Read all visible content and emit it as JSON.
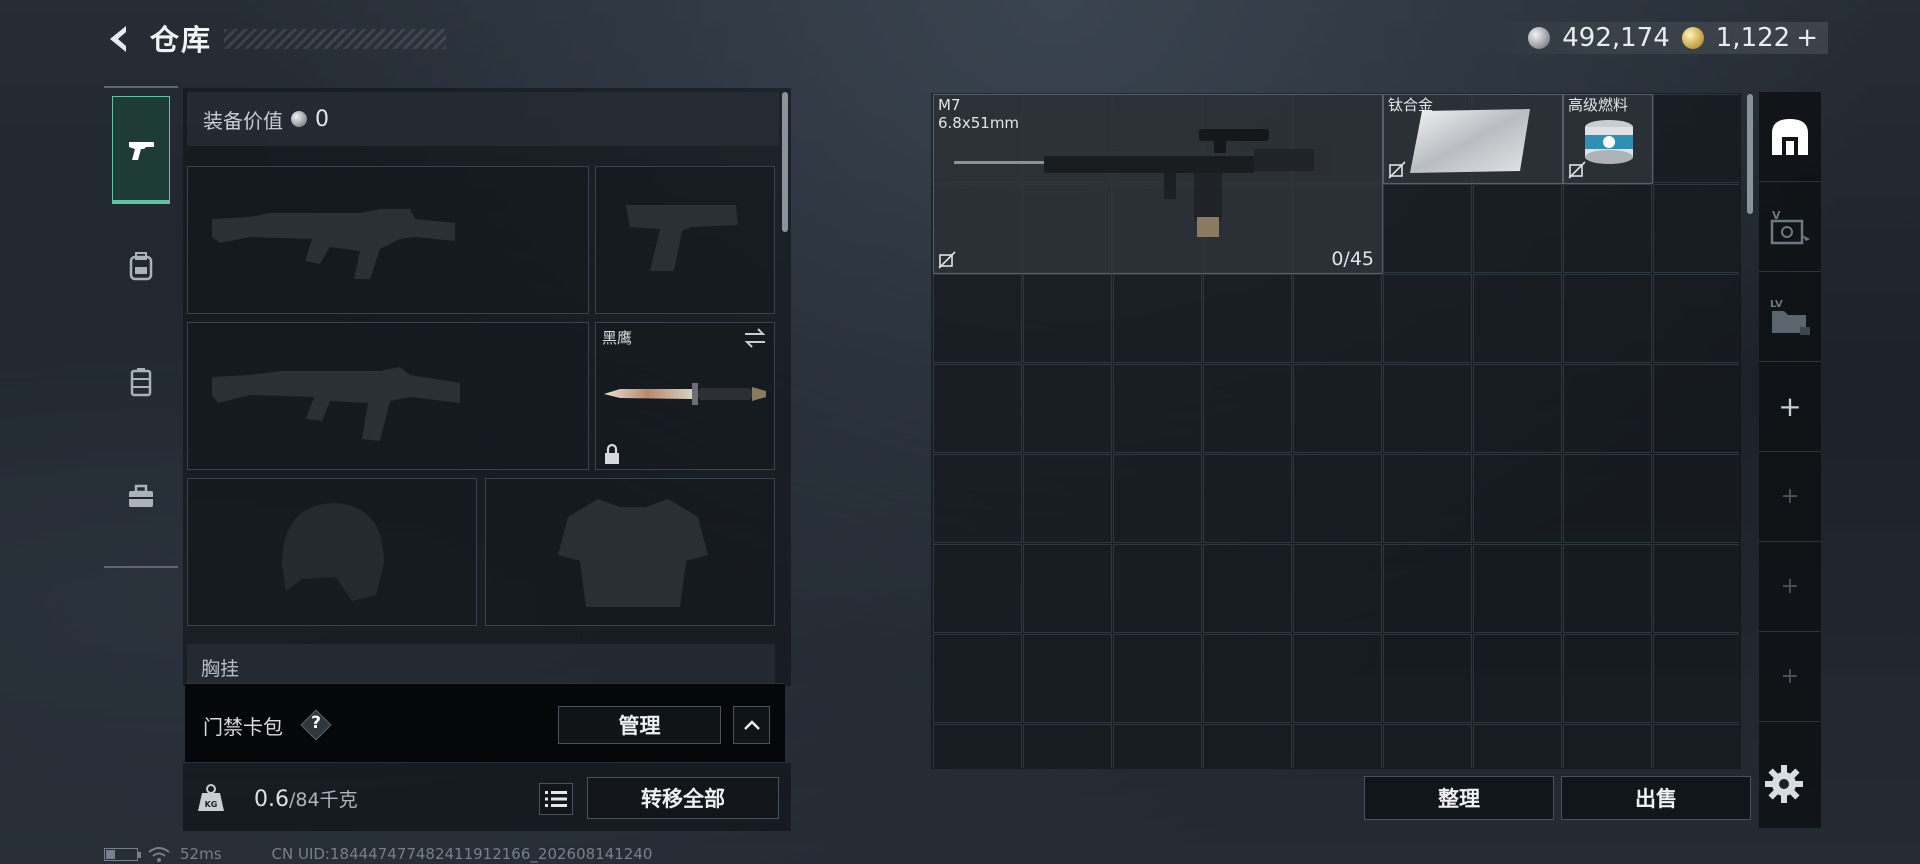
{
  "header": {
    "title": "仓库",
    "currency": [
      {
        "icon": "silver-coin-icon",
        "value": "492,174"
      },
      {
        "icon": "gold-coin-icon",
        "value": "1,122",
        "add": "+"
      }
    ]
  },
  "categories": [
    {
      "name": "weapons",
      "icon": "pistol-icon",
      "active": true
    },
    {
      "name": "backpack",
      "icon": "backpack-icon",
      "active": false
    },
    {
      "name": "rig",
      "icon": "vest-icon",
      "active": false
    },
    {
      "name": "toolbox",
      "icon": "toolbox-icon",
      "active": false
    }
  ],
  "equipment": {
    "title": "装备价值",
    "value": "0",
    "slots": {
      "melee": {
        "label": "黑鹰"
      }
    },
    "chest_label": "胸挂"
  },
  "keycard": {
    "label": "门禁卡包",
    "help": "?",
    "manage_label": "管理"
  },
  "weight": {
    "current": "0.6",
    "capacity": "/84千克",
    "transfer_label": "转移全部"
  },
  "status": {
    "ping": "52ms",
    "uid": "CN UID:1844474774824119121​66_202608141240",
    "battery_level": 0.3
  },
  "storage": {
    "items": [
      {
        "name": "M7",
        "sub": "6.8x51mm",
        "ammo": "0/45"
      },
      {
        "name": "钛合金"
      },
      {
        "name": "高级燃料"
      }
    ],
    "sort_label": "整理",
    "sell_label": "出售"
  },
  "rail": [
    {
      "icon": "storage-icon"
    },
    {
      "icon": "v-case-icon"
    },
    {
      "icon": "lv-folder-icon"
    },
    {
      "icon": "plus-icon",
      "label": "+"
    },
    {
      "icon": "plus-icon",
      "label": "+"
    },
    {
      "icon": "plus-icon",
      "label": "+"
    },
    {
      "icon": "plus-icon",
      "label": "+"
    }
  ],
  "colors": {
    "accent": "#5fc4a3",
    "background": "#1f252c"
  }
}
